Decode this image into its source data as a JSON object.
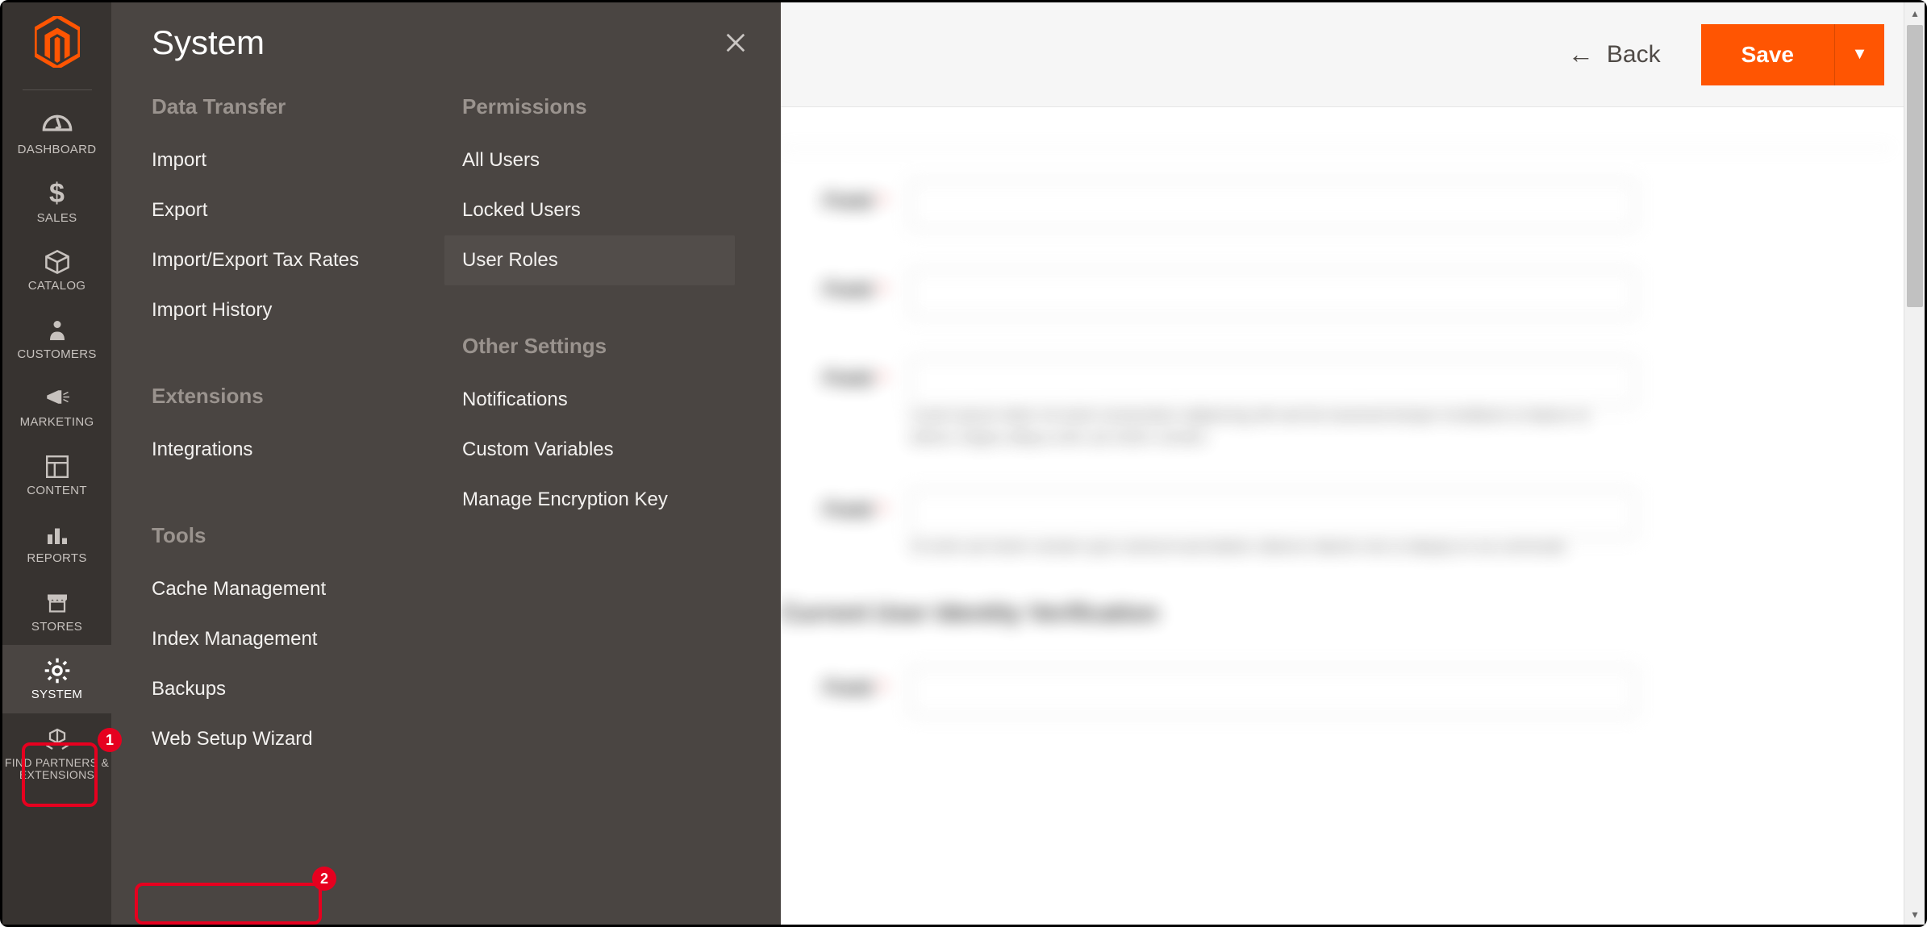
{
  "sidebar": {
    "items": [
      {
        "label": "DASHBOARD",
        "icon": "dashboard-gauge-icon"
      },
      {
        "label": "SALES",
        "icon": "dollar-icon"
      },
      {
        "label": "CATALOG",
        "icon": "cube-icon"
      },
      {
        "label": "CUSTOMERS",
        "icon": "person-icon"
      },
      {
        "label": "MARKETING",
        "icon": "megaphone-icon"
      },
      {
        "label": "CONTENT",
        "icon": "layout-icon"
      },
      {
        "label": "REPORTS",
        "icon": "bar-chart-icon"
      },
      {
        "label": "STORES",
        "icon": "storefront-icon"
      },
      {
        "label": "SYSTEM",
        "icon": "gear-icon"
      },
      {
        "label": "FIND PARTNERS & EXTENSIONS",
        "icon": "package-icon"
      }
    ]
  },
  "flyout": {
    "title": "System",
    "columns": [
      {
        "groups": [
          {
            "title": "Data Transfer",
            "links": [
              "Import",
              "Export",
              "Import/Export Tax Rates",
              "Import History"
            ]
          },
          {
            "title": "Extensions",
            "links": [
              "Integrations"
            ]
          },
          {
            "title": "Tools",
            "links": [
              "Cache Management",
              "Index Management",
              "Backups",
              "Web Setup Wizard"
            ]
          }
        ]
      },
      {
        "groups": [
          {
            "title": "Permissions",
            "links": [
              "All Users",
              "Locked Users",
              "User Roles"
            ]
          },
          {
            "title": "Other Settings",
            "links": [
              "Notifications",
              "Custom Variables",
              "Manage Encryption Key"
            ]
          }
        ]
      }
    ]
  },
  "header": {
    "back_label": "Back",
    "save_label": "Save"
  },
  "annotations": {
    "badge1": "1",
    "badge2": "2"
  }
}
